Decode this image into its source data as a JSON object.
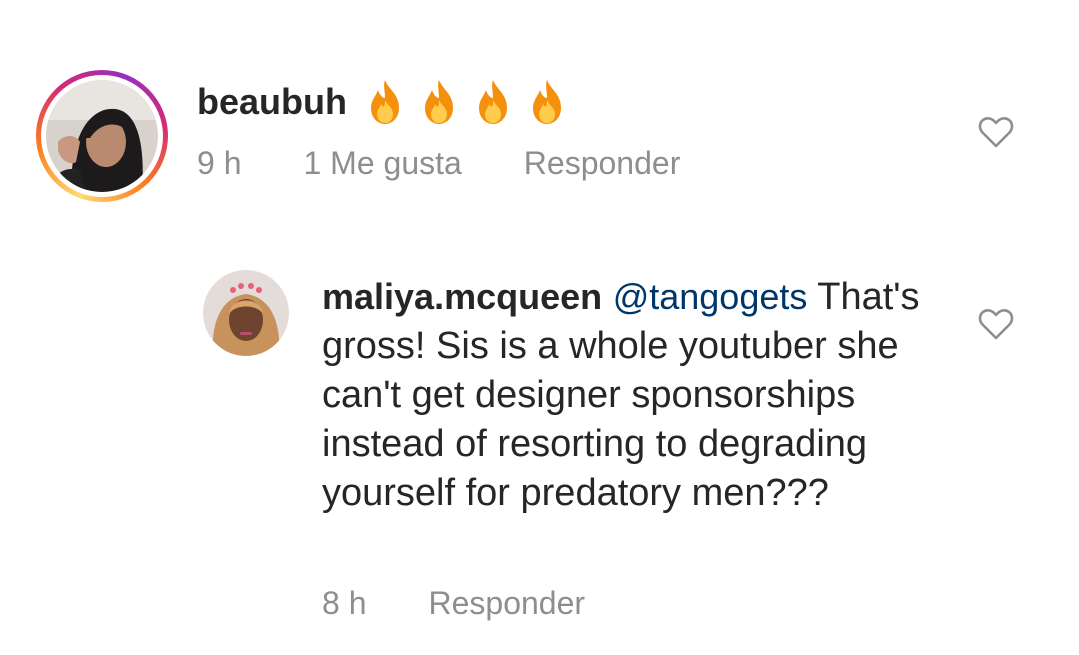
{
  "comments": [
    {
      "username": "beaubuh",
      "emoji": [
        "fire-emoji",
        "fire-emoji",
        "fire-emoji",
        "fire-emoji"
      ],
      "time": "9 h",
      "likes": "1 Me gusta",
      "reply_label": "Responder",
      "has_story_ring": true,
      "like_icon": "heart-outline-icon"
    },
    {
      "username": "maliya.mcqueen",
      "mention": "@tangogets",
      "text": "That's gross! Sis is a whole youtuber she can't get designer sponsorships instead of resorting to degrading yourself for predatory men???",
      "time": "8 h",
      "reply_label": "Responder",
      "like_icon": "heart-outline-icon"
    }
  ],
  "colors": {
    "text_primary": "#262626",
    "text_secondary": "#8e8e8e",
    "mention": "#00376b",
    "background": "#ffffff"
  }
}
